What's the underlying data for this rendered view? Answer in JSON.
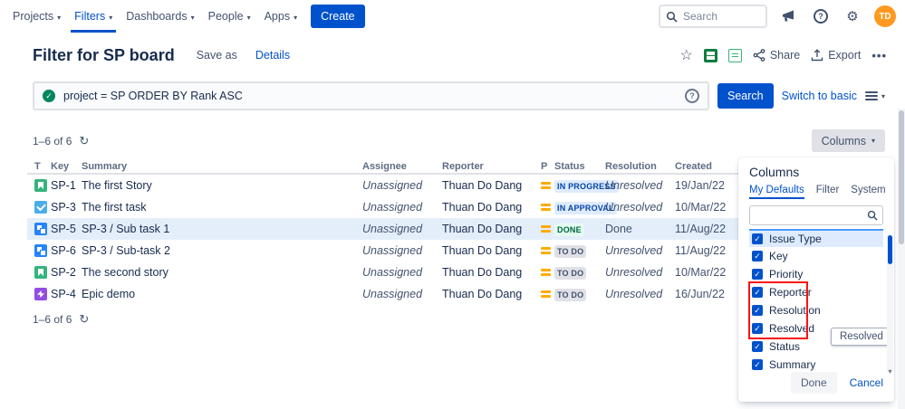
{
  "topnav": {
    "items": [
      {
        "label": "Projects",
        "active": false
      },
      {
        "label": "Filters",
        "active": true
      },
      {
        "label": "Dashboards",
        "active": false
      },
      {
        "label": "People",
        "active": false
      },
      {
        "label": "Apps",
        "active": false
      }
    ],
    "create_label": "Create",
    "search_placeholder": "Search",
    "avatar_initials": "TD"
  },
  "header": {
    "title": "Filter for SP board",
    "save_as_label": "Save as",
    "details_label": "Details",
    "share_label": "Share",
    "export_label": "Export",
    "more_glyph": "•••"
  },
  "jql": {
    "query": "project = SP ORDER BY Rank ASC",
    "search_button_label": "Search",
    "switch_to_basic_label": "Switch to basic"
  },
  "results": {
    "count_top": "1–6 of 6",
    "count_bottom": "1–6 of 6"
  },
  "columns_button_label": "Columns",
  "colors": {
    "accent_blue": "#0052CC",
    "status_blue_bg": "#DEEBFF",
    "status_green_bg": "#E3FCEF",
    "status_grey_bg": "#DFE1E6",
    "annotation_red": "#FB1313",
    "selected_row_bg": "#E4EEFB"
  },
  "issue_table": {
    "headers": [
      "T",
      "Key",
      "Summary",
      "Assignee",
      "Reporter",
      "P",
      "Status",
      "Resolution",
      "Created"
    ],
    "rows": [
      {
        "type": "story",
        "key": "SP-1",
        "summary": "The first Story",
        "assignee": "Unassigned",
        "reporter": "Thuan Do Dang",
        "priority": "medium",
        "status": "IN PROGRESS",
        "status_color": "blue",
        "resolution": "Unresolved",
        "created": "19/Jan/22",
        "selected": false
      },
      {
        "type": "task",
        "key": "SP-3",
        "summary": "The first task",
        "assignee": "Unassigned",
        "reporter": "Thuan Do Dang",
        "priority": "medium",
        "status": "IN APPROVAL",
        "status_color": "blue",
        "resolution": "Unresolved",
        "created": "10/Mar/22",
        "selected": false
      },
      {
        "type": "subtask",
        "key": "SP-5",
        "summary": "SP-3 / Sub task 1",
        "assignee": "Unassigned",
        "reporter": "Thuan Do Dang",
        "priority": "medium",
        "status": "DONE",
        "status_color": "green",
        "resolution": "Done",
        "created": "11/Aug/22",
        "selected": true
      },
      {
        "type": "subtask",
        "key": "SP-6",
        "summary": "SP-3 / Sub-task 2",
        "assignee": "Unassigned",
        "reporter": "Thuan Do Dang",
        "priority": "medium",
        "status": "TO DO",
        "status_color": "grey",
        "resolution": "Unresolved",
        "created": "11/Aug/22",
        "selected": false
      },
      {
        "type": "story",
        "key": "SP-2",
        "summary": "The second story",
        "assignee": "Unassigned",
        "reporter": "Thuan Do Dang",
        "priority": "medium",
        "status": "TO DO",
        "status_color": "grey",
        "resolution": "Unresolved",
        "created": "10/Mar/22",
        "selected": false
      },
      {
        "type": "epic",
        "key": "SP-4",
        "summary": "Epic demo",
        "assignee": "Unassigned",
        "reporter": "Thuan Do Dang",
        "priority": "medium",
        "status": "TO DO",
        "status_color": "grey",
        "resolution": "Unresolved",
        "created": "16/Jun/22",
        "selected": false
      }
    ]
  },
  "columns_panel": {
    "title": "Columns",
    "tabs": [
      {
        "label": "My Defaults",
        "active": true
      },
      {
        "label": "Filter",
        "active": false
      },
      {
        "label": "System",
        "active": false
      }
    ],
    "items": [
      {
        "label": "Issue Type",
        "checked": true,
        "highlighted": true
      },
      {
        "label": "Key",
        "checked": true,
        "highlighted": false
      },
      {
        "label": "Priority",
        "checked": true,
        "highlighted": false
      },
      {
        "label": "Reporter",
        "checked": true,
        "highlighted": false
      },
      {
        "label": "Resolution",
        "checked": true,
        "highlighted": false
      },
      {
        "label": "Resolved",
        "checked": true,
        "highlighted": false
      },
      {
        "label": "Status",
        "checked": true,
        "highlighted": false
      },
      {
        "label": "Summary",
        "checked": true,
        "highlighted": false
      }
    ],
    "drag_ghost_label": "Resolved",
    "done_label": "Done",
    "cancel_label": "Cancel"
  }
}
